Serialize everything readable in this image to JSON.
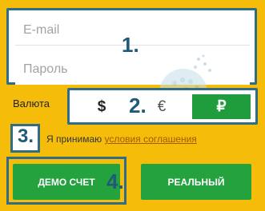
{
  "form": {
    "email_placeholder": "E-mail",
    "password_placeholder": "Пароль"
  },
  "currency": {
    "label": "Валюта",
    "options": [
      "$",
      "€",
      "₽"
    ],
    "selected": "₽"
  },
  "terms": {
    "prefix": "Я принимаю",
    "link": "условия соглашения"
  },
  "buttons": {
    "demo": "ДЕМО СЧЕТ",
    "real": "РЕАЛЬНЫЙ"
  },
  "markers": [
    "1.",
    "2.",
    "3.",
    "4."
  ],
  "colors": {
    "background": "#f5bd0a",
    "highlight": "#2f6d86",
    "button": "#23a23e",
    "link": "#a45a00"
  }
}
